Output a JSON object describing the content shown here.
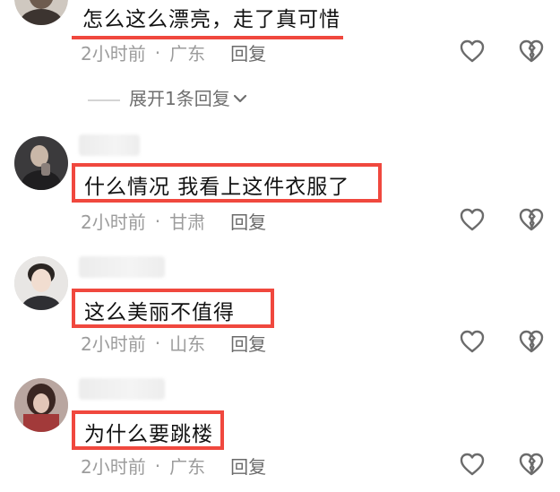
{
  "comments": [
    {
      "text": "怎么这么漂亮，走了真可惜",
      "time": "2小时前",
      "separator": "·",
      "location": "广东",
      "reply_label": "回复"
    },
    {
      "text": "什么情况 我看上这件衣服了",
      "time": "2小时前",
      "separator": "·",
      "location": "甘肃",
      "reply_label": "回复"
    },
    {
      "text": "这么美丽不值得",
      "time": "2小时前",
      "separator": "·",
      "location": "山东",
      "reply_label": "回复"
    },
    {
      "text": "为什么要跳楼",
      "time": "2小时前",
      "separator": "·",
      "location": "广东",
      "reply_label": "回复"
    }
  ],
  "expand_replies": {
    "label": "展开1条回复",
    "icon": "chevron-down-icon"
  },
  "icons": {
    "like": "heart-outline-icon",
    "dislike": "broken-heart-icon"
  },
  "colors": {
    "highlight": "#f0483e",
    "meta": "#9c9c9c",
    "text": "#121212"
  }
}
